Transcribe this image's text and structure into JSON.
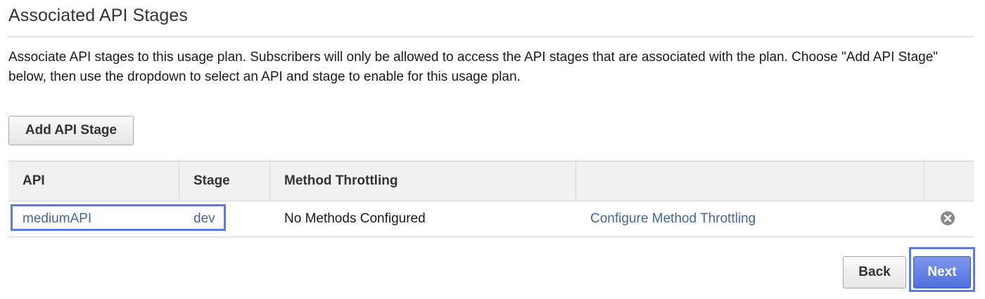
{
  "section": {
    "title": "Associated API Stages",
    "description": "Associate API stages to this usage plan. Subscribers will only be allowed to access the API stages that are associated with the plan. Choose \"Add API Stage\" below, then use the dropdown to select an API and stage to enable for this usage plan."
  },
  "toolbar": {
    "add_stage_label": "Add API Stage"
  },
  "table": {
    "columns": [
      "API",
      "Stage",
      "Method Throttling",
      "",
      ""
    ],
    "rows": [
      {
        "api": "mediumAPI",
        "stage": "dev",
        "method_throttling": "No Methods Configured",
        "action_link": "Configure Method Throttling",
        "remove_icon": "remove-circle-icon"
      }
    ]
  },
  "footer": {
    "back_label": "Back",
    "next_label": "Next"
  },
  "colors": {
    "link": "#44679b",
    "primary_button": "#5a7be0",
    "highlight": "#5a7be0"
  }
}
